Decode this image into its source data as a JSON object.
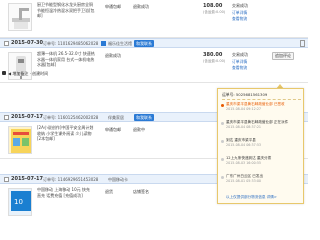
{
  "orders": [
    {
      "item_title": "厨卫节能型钢化水龙头厨房全铜节能恒温冷热混水双把手卫浴[包邮]",
      "seller": "申通包邮",
      "payment": "退款成功",
      "price": "108.00",
      "price_sub": "(含运费:0.00)",
      "status": "交易成功",
      "links": [
        "订单详情",
        "查看物流"
      ]
    }
  ],
  "order2": {
    "date": "2015-07-30",
    "order_id_label": "订单号: 1101629485062028",
    "shop": "福乐佳生活馆",
    "ww": "和我联系",
    "item_title": "超薄一体机 26.5-32.0寸 快速热水器一体机家用 台式一体机电热水器[包邮]",
    "seller": "退款成功",
    "price": "380.00",
    "price_sub": "(含运费:0.00)",
    "status": "交易成功",
    "links": [
      "订单详情",
      "查看物流"
    ],
    "btn": "追加评论"
  },
  "remark": "◀ 增加备注 · 创建时间",
  "popup": {
    "head": "运单号: 5025681561309",
    "steps": [
      {
        "text": "重庆市梁平县黄石邮政营业部 已签收",
        "time": "2015-08-04 09:12:27",
        "cur": true
      },
      {
        "text": "重庆市梁平县黄石邮政营业部 正在派件",
        "time": "2015-08-04 08:37:21",
        "cur": false
      },
      {
        "text": "到达 重庆市梁平县",
        "time": "2015-08-04 06:37:53",
        "cur": false
      },
      {
        "text": "12上九条快递到达 重庆分拨",
        "time": "2015-08-03 16:00:55",
        "cur": false
      },
      {
        "text": "广东广州白云区 已发出",
        "time": "2015-08-01 05:33:00",
        "cur": false
      }
    ],
    "more": "以上仅提供部分物流信息 详情>"
  },
  "order3": {
    "date": "2015-07-17",
    "order_id_label": "订单号: 1160125462002028",
    "shop": "伴美家居",
    "ww": "和我联系",
    "item_title": "[2A小说创作]中国平安全周计划收纳 小学生课外阅读 少儿读物[2本包邮]",
    "seller": "申通包邮",
    "payment": "退款中",
    "price": "",
    "status": ""
  },
  "order4": {
    "date": "2015-07-17",
    "order_id_label": "订单号: 1146929651453028",
    "shop": "中国移动卡",
    "ww": "",
    "item_title": "中国移动 上海移动 10元 快充 直充 话费充值 [充值成功]",
    "seller": "退货",
    "payment": "店铺签名",
    "price": "",
    "status": ""
  },
  "colors": {
    "accent": "#e85a00",
    "link": "#2a6dc2",
    "header": "#e9f1fb",
    "popup_border": "#e8c86c"
  }
}
